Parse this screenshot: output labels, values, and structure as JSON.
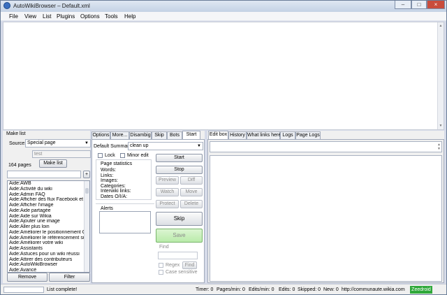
{
  "app": {
    "title": "AutoWikiBrowser – Default.xml"
  },
  "menu": [
    "File",
    "View",
    "List",
    "Plugins",
    "Options",
    "Tools",
    "Help"
  ],
  "makelist": {
    "header": "Make list",
    "source_label": "Source:",
    "source_value": "Special page",
    "query_value": "test",
    "pages_count": "164 pages",
    "makelist_button": "Make list",
    "items": [
      "Aide:AWB",
      "Aide:Activité du wiki",
      "Aide:Admin FAQ",
      "Aide:Afficher des flux Facebook et",
      "Aide:Afficher l'image",
      "Aide:Aide partagée",
      "Aide:Aide sur Wikia",
      "Aide:Ajouter une image",
      "Aide:Aller plus loin",
      "Aide:Améliorer le positionnement G",
      "Aide:Améliorer le référencement sur",
      "Aide:Améliorer votre wiki",
      "Aide:Assistants",
      "Aide:Astuces pour un wiki réussi",
      "Aide:Attirer des contributeurs",
      "Aide:AutoWikiBrowser",
      "Aide:Avancé"
    ],
    "remove_button": "Remove",
    "filter_button": "Filter"
  },
  "tabs": [
    "Options",
    "More...",
    "Disambig",
    "Skip",
    "Bots",
    "Start"
  ],
  "start": {
    "summary_label": "Default Summary",
    "summary_value": "clean up",
    "lock_label": "Lock",
    "minor_label": "Minor edit",
    "stats_header": "Page statistics",
    "stats": [
      "Words:",
      "Links:",
      "Images:",
      "Categories:",
      "Interwiki links:",
      "Dates O/I/A:"
    ],
    "alerts_label": "Alerts",
    "start_button": "Start",
    "stop_button": "Stop",
    "preview_button": "Preview",
    "diff_button": "Diff",
    "watch_button": "Watch",
    "move_button": "Move",
    "protect_button": "Protect",
    "delete_button": "Delete",
    "skip_button": "Skip",
    "save_button": "Save",
    "find_label": "Find",
    "regex_label": "Regex",
    "find_button": "Find",
    "case_label": "Case sensitive"
  },
  "edit_tabs": [
    "Edit box",
    "History",
    "What links here",
    "Logs",
    "Page Logs"
  ],
  "status": {
    "text": "List complete!",
    "timer": "Timer: 0",
    "pages_min": "Pages/min: 0",
    "edits_min": "Edits/min: 0",
    "edits": "Edits: 0",
    "skipped": "Skipped: 0",
    "new": "New: 0",
    "url": "http://communaute.wikia.com",
    "user": "Zeedroid"
  }
}
